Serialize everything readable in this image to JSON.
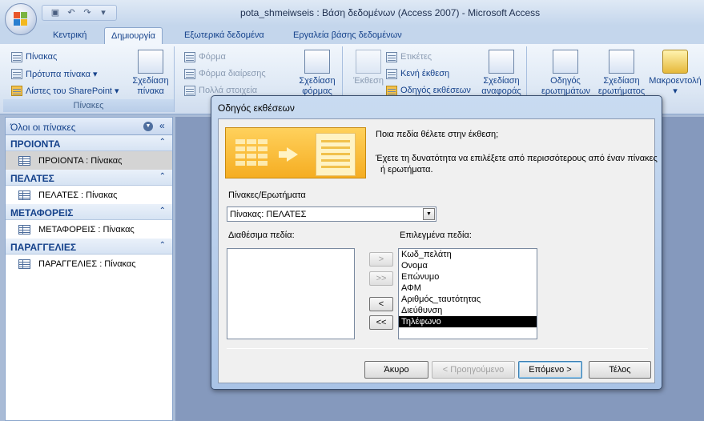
{
  "window": {
    "title": "pota_shmeiwseis : Βάση δεδομένων (Access 2007) - Microsoft Access"
  },
  "qat": {
    "icons": [
      "save-icon",
      "undo-icon",
      "redo-icon",
      "customize-icon"
    ]
  },
  "tabs": [
    {
      "label": "Κεντρική"
    },
    {
      "label": "Δημιουργία"
    },
    {
      "label": "Εξωτερικά δεδομένα"
    },
    {
      "label": "Εργαλεία βάσης δεδομένων"
    }
  ],
  "ribbon": {
    "tables": {
      "table": "Πίνακας",
      "templates": "Πρότυπα πίνακα ▾",
      "sharepoint": "Λίστες του SharePoint ▾",
      "design": "Σχεδίαση",
      "design2": "πίνακα",
      "group_label": "Πίνακες"
    },
    "forms": {
      "form": "Φόρμα",
      "split": "Φόρμα διαίρεσης",
      "multi": "Πολλά στοιχεία",
      "design": "Σχεδίαση",
      "design2": "φόρμας"
    },
    "reports": {
      "report": "Έκθεση",
      "labels": "Ετικέτες",
      "blank": "Κενή έκθεση",
      "wizard": "Οδηγός εκθέσεων",
      "design": "Σχεδίαση",
      "design2": "αναφοράς"
    },
    "other": {
      "query_wizard": "Οδηγός",
      "query_wizard2": "ερωτημάτων",
      "query_design": "Σχεδίαση",
      "query_design2": "ερωτήματος",
      "macro": "Μακροεντολή",
      "macro2": "▾"
    }
  },
  "nav": {
    "header": "Όλοι οι πίνακες",
    "groups": [
      {
        "label": "ΠΡΟΙΟΝΤΑ",
        "item": "ΠΡΟΙΟΝΤΑ : Πίνακας"
      },
      {
        "label": "ΠΕΛΑΤΕΣ",
        "item": "ΠΕΛΑΤΕΣ : Πίνακας"
      },
      {
        "label": "ΜΕΤΑΦΟΡΕΙΣ",
        "item": "ΜΕΤΑΦΟΡΕΙΣ : Πίνακας"
      },
      {
        "label": "ΠΑΡΑΓΓΕΛΙΕΣ",
        "item": "ΠΑΡΑΓΓΕΛΙΕΣ : Πίνακας"
      }
    ]
  },
  "dialog": {
    "title": "Οδηγός εκθέσεων",
    "question": "Ποια πεδία θέλετε στην έκθεση;",
    "hint1": "Έχετε τη δυνατότητα να επιλέξετε από περισσότερους από έναν πίνακες",
    "hint2": "ή ερωτήματα.",
    "tables_label": "Πίνακες/Ερωτήματα",
    "tables_value": "Πίνακας: ΠΕΛΑΤΕΣ",
    "available_label": "Διαθέσιμα πεδία:",
    "selected_label": "Επιλεγμένα πεδία:",
    "selected_fields": [
      "Κωδ_πελάτη",
      "Ονομα",
      "Επώνυμο",
      "ΑΦΜ",
      "Αριθμός_ταυτότητας",
      "Διεύθυνση",
      "Τηλέφωνο"
    ],
    "selected_highlight": "Τηλέφωνο",
    "move": {
      "add": ">",
      "add_all": ">>",
      "remove": "<",
      "remove_all": "<<"
    },
    "buttons": {
      "cancel": "Άκυρο",
      "back": "< Προηγούμενο",
      "next": "Επόμενο >",
      "finish": "Τέλος"
    }
  }
}
